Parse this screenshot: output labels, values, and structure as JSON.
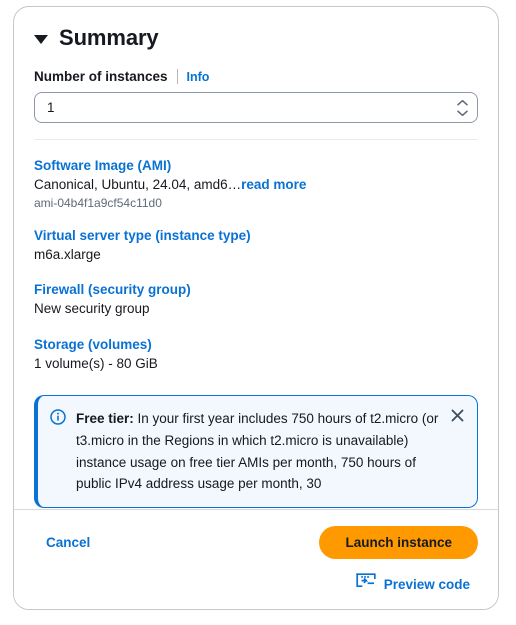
{
  "panel": {
    "title": "Summary",
    "collapse_caret": "caret-down-icon"
  },
  "instances": {
    "label": "Number of instances",
    "info_link": "Info",
    "value": "1",
    "placeholder": ""
  },
  "sections": [
    {
      "title": "Software Image (AMI)",
      "value": "Canonical, Ubuntu, 24.04, amd6…",
      "link": "read more",
      "sub_value": "ami-04b4f1a9cf54c11d0"
    },
    {
      "title": "Virtual server type (instance type)",
      "value": "m6a.xlarge"
    },
    {
      "title": "Firewall (security group)",
      "value": "New security group"
    },
    {
      "title": "Storage (volumes)",
      "value": "1 volume(s) - 80 GiB"
    }
  ],
  "alert": {
    "icon": "info-circle-icon",
    "strong": "Free tier:",
    "text": " In your first year includes 750 hours of t2.micro (or t3.micro in the Regions in which t2.micro is unavailable) instance usage on free tier AMIs per month, 750 hours of public IPv4 address usage per month, 30",
    "close_icon": "close-icon"
  },
  "footer": {
    "cancel": "Cancel",
    "launch": "Launch instance",
    "preview_code": "Preview code",
    "preview_icon": "code-terminal-icon"
  },
  "colors": {
    "link_blue": "#0972d3",
    "orange": "#ff9900",
    "alert_bg": "#f2f8fd",
    "text": "#16191f"
  }
}
